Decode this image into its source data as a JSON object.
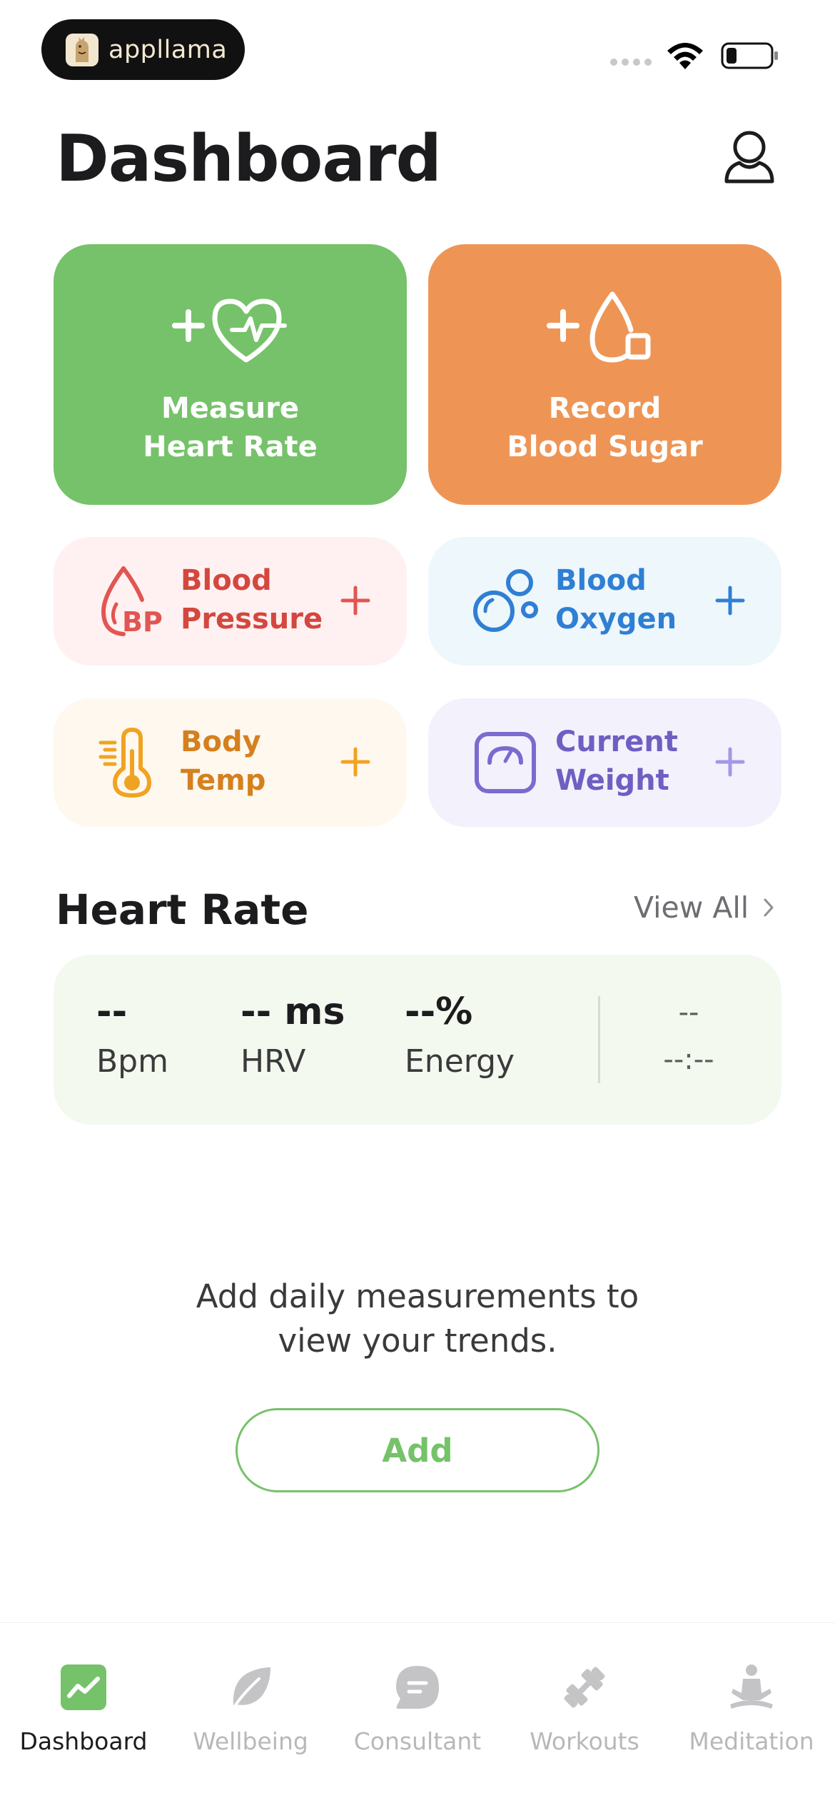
{
  "status_bar": {
    "app_badge": "appllama",
    "logo_icon": "llama-logo-icon",
    "wifi_icon": "wifi-icon",
    "battery_icon": "battery-icon"
  },
  "header": {
    "title": "Dashboard",
    "profile_icon": "person-icon"
  },
  "actions": [
    {
      "label": "Measure\nHeart Rate",
      "icon": "heart-pulse-plus-icon",
      "color": "#76c26a"
    },
    {
      "label": "Record\nBlood Sugar",
      "icon": "drop-plus-icon",
      "color": "#ee9556"
    }
  ],
  "metrics": [
    {
      "label": "Blood\nPressure",
      "icon": "blood-pressure-drop-icon",
      "color": "#d4473f",
      "bg": "#fff1f1"
    },
    {
      "label": "Blood\nOxygen",
      "icon": "bubbles-icon",
      "color": "#2f7fd4",
      "bg": "#eef7fb"
    },
    {
      "label": "Body\nTemp",
      "icon": "thermometer-icon",
      "color": "#d5801f",
      "bg": "#fff8ee"
    },
    {
      "label": "Current\nWeight",
      "icon": "scale-icon",
      "color": "#6e5fc2",
      "bg": "#f3f1fc"
    }
  ],
  "heart_rate": {
    "title": "Heart Rate",
    "view_all": "View All",
    "bpm_value": "--",
    "bpm_label": "Bpm",
    "hrv_value": "-- ms",
    "hrv_label": "HRV",
    "energy_value": "--%",
    "energy_label": "Energy",
    "date_value": "--",
    "time_value": "--:--"
  },
  "empty_state": {
    "message": "Add daily measurements to\nview your trends.",
    "button": "Add"
  },
  "tab_bar": {
    "tabs": [
      {
        "label": "Dashboard",
        "icon": "chart-trend-icon",
        "active": true
      },
      {
        "label": "Wellbeing",
        "icon": "leaf-icon",
        "active": false
      },
      {
        "label": "Consultant",
        "icon": "chat-bubble-icon",
        "active": false
      },
      {
        "label": "Workouts",
        "icon": "dumbbell-icon",
        "active": false
      },
      {
        "label": "Meditation",
        "icon": "meditation-icon",
        "active": false
      }
    ],
    "accent": "#76c26a",
    "inactive": "#c4c4c7"
  }
}
